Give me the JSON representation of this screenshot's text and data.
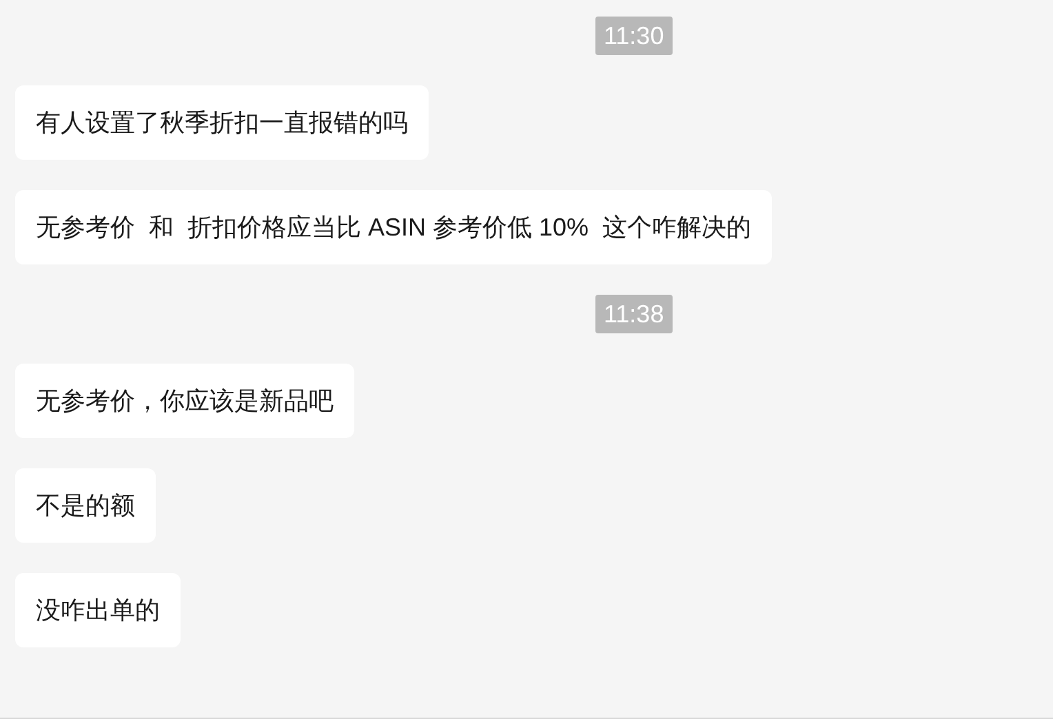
{
  "messages": [
    {
      "kind": "time",
      "text": "11:30"
    },
    {
      "kind": "message",
      "text": "有人设置了秋季折扣一直报错的吗"
    },
    {
      "kind": "message",
      "text": "无参考价  和  折扣价格应当比 ASIN 参考价低 10%  这个咋解决的"
    },
    {
      "kind": "time",
      "text": "11:38"
    },
    {
      "kind": "message",
      "text": "无参考价，你应该是新品吧"
    },
    {
      "kind": "message",
      "text": "不是的额"
    },
    {
      "kind": "message",
      "text": "没咋出单的"
    }
  ]
}
